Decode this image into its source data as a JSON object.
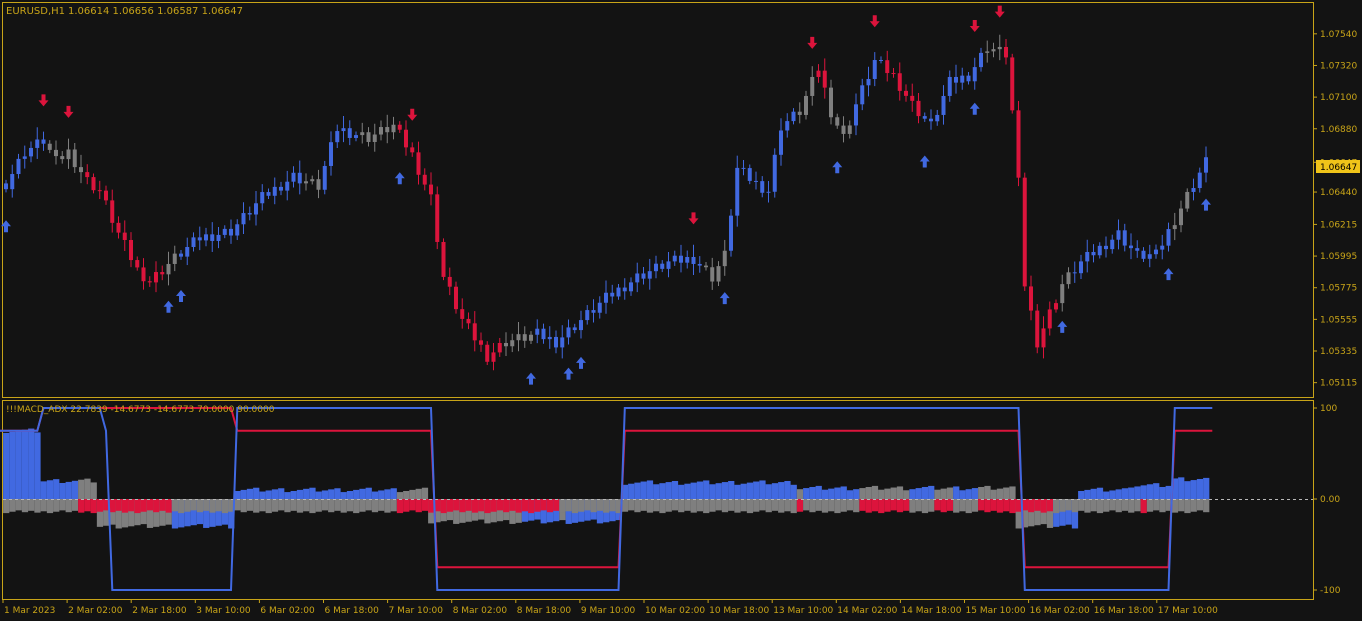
{
  "colors": {
    "background": "#131313",
    "frame": "#c8a418",
    "text": "#c8a418",
    "bull": "#4169e1",
    "bear": "#dc143c",
    "neutral": "#7f7f7f",
    "price_tag_bg": "#f0c419",
    "price_tag_text": "#000000"
  },
  "main_header": {
    "symbol": "EURUSD,H1",
    "ohlc": "1.06614 1.06656 1.06587 1.06647"
  },
  "indicator_header": {
    "label": "!!!MACD_ADX 22.7839 -14.6773 -14.6773 70.0000 90.0000"
  },
  "price_axis": {
    "ticks": [
      "1.07540",
      "1.07320",
      "1.07100",
      "1.06880",
      "1.06647",
      "1.06440",
      "1.06215",
      "1.05995",
      "1.05775",
      "1.05555",
      "1.05335",
      "1.05115"
    ],
    "current_price_label": "1.06647"
  },
  "indicator_axis": {
    "ticks": [
      "100",
      "0.00",
      "-100"
    ]
  },
  "time_axis": {
    "labels": [
      "1 Mar 2023",
      "2 Mar 02:00",
      "2 Mar 18:00",
      "3 Mar 10:00",
      "6 Mar 02:00",
      "6 Mar 18:00",
      "7 Mar 10:00",
      "8 Mar 02:00",
      "8 Mar 18:00",
      "9 Mar 10:00",
      "10 Mar 02:00",
      "10 Mar 18:00",
      "13 Mar 10:00",
      "14 Mar 02:00",
      "14 Mar 18:00",
      "15 Mar 10:00",
      "16 Mar 02:00",
      "16 Mar 18:00",
      "17 Mar 10:00"
    ]
  },
  "chart_data": [
    {
      "type": "candlestick",
      "title": "EURUSD,H1",
      "ylim": [
        1.0505,
        1.0765
      ],
      "candle_count": 193,
      "close_path": [
        {
          "i": 0,
          "v": 1.065
        },
        {
          "i": 3,
          "v": 1.0672
        },
        {
          "i": 6,
          "v": 1.068
        },
        {
          "i": 8,
          "v": 1.0665
        },
        {
          "i": 10,
          "v": 1.0672
        },
        {
          "i": 13,
          "v": 1.0652
        },
        {
          "i": 15,
          "v": 1.0645
        },
        {
          "i": 18,
          "v": 1.0615
        },
        {
          "i": 21,
          "v": 1.059
        },
        {
          "i": 23,
          "v": 1.0582
        },
        {
          "i": 27,
          "v": 1.0598
        },
        {
          "i": 31,
          "v": 1.0612
        },
        {
          "i": 36,
          "v": 1.0617
        },
        {
          "i": 41,
          "v": 1.064
        },
        {
          "i": 46,
          "v": 1.0655
        },
        {
          "i": 50,
          "v": 1.0648
        },
        {
          "i": 53,
          "v": 1.0688
        },
        {
          "i": 58,
          "v": 1.0682
        },
        {
          "i": 62,
          "v": 1.069
        },
        {
          "i": 65,
          "v": 1.067
        },
        {
          "i": 68,
          "v": 1.064
        },
        {
          "i": 70,
          "v": 1.0585
        },
        {
          "i": 73,
          "v": 1.0555
        },
        {
          "i": 77,
          "v": 1.053
        },
        {
          "i": 80,
          "v": 1.054
        },
        {
          "i": 85,
          "v": 1.0545
        },
        {
          "i": 88,
          "v": 1.054
        },
        {
          "i": 92,
          "v": 1.0555
        },
        {
          "i": 96,
          "v": 1.057
        },
        {
          "i": 101,
          "v": 1.0585
        },
        {
          "i": 106,
          "v": 1.0595
        },
        {
          "i": 110,
          "v": 1.0598
        },
        {
          "i": 113,
          "v": 1.0585
        },
        {
          "i": 115,
          "v": 1.06
        },
        {
          "i": 117,
          "v": 1.066
        },
        {
          "i": 120,
          "v": 1.065
        },
        {
          "i": 122,
          "v": 1.0645
        },
        {
          "i": 124,
          "v": 1.069
        },
        {
          "i": 127,
          "v": 1.07
        },
        {
          "i": 130,
          "v": 1.073
        },
        {
          "i": 132,
          "v": 1.07
        },
        {
          "i": 134,
          "v": 1.0682
        },
        {
          "i": 136,
          "v": 1.0705
        },
        {
          "i": 139,
          "v": 1.0735
        },
        {
          "i": 142,
          "v": 1.0725
        },
        {
          "i": 145,
          "v": 1.0705
        },
        {
          "i": 148,
          "v": 1.069
        },
        {
          "i": 151,
          "v": 1.072
        },
        {
          "i": 154,
          "v": 1.0725
        },
        {
          "i": 157,
          "v": 1.0745
        },
        {
          "i": 160,
          "v": 1.074
        },
        {
          "i": 161,
          "v": 1.07
        },
        {
          "i": 162,
          "v": 1.065
        },
        {
          "i": 163,
          "v": 1.058
        },
        {
          "i": 165,
          "v": 1.054
        },
        {
          "i": 167,
          "v": 1.056
        },
        {
          "i": 169,
          "v": 1.058
        },
        {
          "i": 172,
          "v": 1.0595
        },
        {
          "i": 175,
          "v": 1.0605
        },
        {
          "i": 178,
          "v": 1.0615
        },
        {
          "i": 181,
          "v": 1.06
        },
        {
          "i": 184,
          "v": 1.06
        },
        {
          "i": 187,
          "v": 1.0625
        },
        {
          "i": 190,
          "v": 1.065
        },
        {
          "i": 192,
          "v": 1.0665
        }
      ],
      "candle_color_runs": [
        {
          "from": 0,
          "to": 6,
          "color": "bull"
        },
        {
          "from": 7,
          "to": 12,
          "color": "neutral"
        },
        {
          "from": 13,
          "to": 25,
          "color": "bear"
        },
        {
          "from": 26,
          "to": 27,
          "color": "neutral"
        },
        {
          "from": 28,
          "to": 47,
          "color": "bull"
        },
        {
          "from": 48,
          "to": 50,
          "color": "neutral"
        },
        {
          "from": 51,
          "to": 56,
          "color": "bull"
        },
        {
          "from": 57,
          "to": 62,
          "color": "neutral"
        },
        {
          "from": 63,
          "to": 79,
          "color": "bear"
        },
        {
          "from": 80,
          "to": 84,
          "color": "neutral"
        },
        {
          "from": 85,
          "to": 90,
          "color": "bull"
        },
        {
          "from": 91,
          "to": 111,
          "color": "bull"
        },
        {
          "from": 112,
          "to": 115,
          "color": "neutral"
        },
        {
          "from": 116,
          "to": 126,
          "color": "bull"
        },
        {
          "from": 127,
          "to": 129,
          "color": "neutral"
        },
        {
          "from": 130,
          "to": 131,
          "color": "bear"
        },
        {
          "from": 132,
          "to": 135,
          "color": "neutral"
        },
        {
          "from": 136,
          "to": 140,
          "color": "bull"
        },
        {
          "from": 141,
          "to": 146,
          "color": "bear"
        },
        {
          "from": 147,
          "to": 156,
          "color": "bull"
        },
        {
          "from": 157,
          "to": 159,
          "color": "neutral"
        },
        {
          "from": 160,
          "to": 168,
          "color": "bear"
        },
        {
          "from": 169,
          "to": 170,
          "color": "neutral"
        },
        {
          "from": 171,
          "to": 186,
          "color": "bull"
        },
        {
          "from": 187,
          "to": 189,
          "color": "neutral"
        },
        {
          "from": 190,
          "to": 192,
          "color": "bull"
        }
      ],
      "sell_arrows": [
        6,
        10,
        65,
        110,
        129,
        139,
        155,
        159
      ],
      "buy_arrows": [
        0,
        26,
        28,
        63,
        84,
        90,
        92,
        115,
        133,
        147,
        155,
        169,
        186,
        192
      ]
    },
    {
      "type": "histogram",
      "title": "!!!MACD_ADX",
      "ylim": [
        -100,
        100
      ],
      "bars": 193,
      "upper_segments": [
        {
          "from": -3,
          "to": 6,
          "v": 75
        },
        {
          "from": 6,
          "to": 15,
          "v": 20
        },
        {
          "from": 15,
          "to": 37,
          "v": -30
        },
        {
          "from": 37,
          "to": 68,
          "v": 10
        },
        {
          "from": 68,
          "to": 99,
          "v": -25
        },
        {
          "from": 99,
          "to": 127,
          "v": 18
        },
        {
          "from": 127,
          "to": 162,
          "v": 12
        },
        {
          "from": 162,
          "to": 172,
          "v": -30
        },
        {
          "from": 172,
          "to": 180,
          "v": 10
        },
        {
          "from": 180,
          "to": 187,
          "v": 15
        },
        {
          "from": 187,
          "to": 193,
          "v": 22
        }
      ],
      "lower_segments": [
        {
          "from": -3,
          "to": 193,
          "v": -14
        }
      ],
      "upper_color_runs": [
        {
          "from": 0,
          "to": 11,
          "color": "bull"
        },
        {
          "from": 12,
          "to": 26,
          "color": "neutral"
        },
        {
          "from": 27,
          "to": 62,
          "color": "bull"
        },
        {
          "from": 63,
          "to": 82,
          "color": "neutral"
        },
        {
          "from": 83,
          "to": 88,
          "color": "bull"
        },
        {
          "from": 89,
          "to": 89,
          "color": "neutral"
        },
        {
          "from": 90,
          "to": 126,
          "color": "bull"
        },
        {
          "from": 127,
          "to": 127,
          "color": "neutral"
        },
        {
          "from": 128,
          "to": 136,
          "color": "bull"
        },
        {
          "from": 137,
          "to": 144,
          "color": "neutral"
        },
        {
          "from": 145,
          "to": 148,
          "color": "bull"
        },
        {
          "from": 149,
          "to": 151,
          "color": "neutral"
        },
        {
          "from": 152,
          "to": 155,
          "color": "bull"
        },
        {
          "from": 156,
          "to": 167,
          "color": "neutral"
        },
        {
          "from": 168,
          "to": 181,
          "color": "bull"
        },
        {
          "from": 182,
          "to": 192,
          "color": "bull"
        }
      ],
      "lower_color_runs": [
        {
          "from": 0,
          "to": 11,
          "color": "neutral"
        },
        {
          "from": 12,
          "to": 26,
          "color": "bear"
        },
        {
          "from": 27,
          "to": 62,
          "color": "neutral"
        },
        {
          "from": 63,
          "to": 82,
          "color": "bear"
        },
        {
          "from": 83,
          "to": 88,
          "color": "bear"
        },
        {
          "from": 89,
          "to": 89,
          "color": "neutral"
        },
        {
          "from": 90,
          "to": 126,
          "color": "neutral"
        },
        {
          "from": 127,
          "to": 127,
          "color": "bear"
        },
        {
          "from": 128,
          "to": 136,
          "color": "neutral"
        },
        {
          "from": 137,
          "to": 144,
          "color": "bear"
        },
        {
          "from": 145,
          "to": 148,
          "color": "neutral"
        },
        {
          "from": 149,
          "to": 151,
          "color": "bear"
        },
        {
          "from": 152,
          "to": 155,
          "color": "neutral"
        },
        {
          "from": 156,
          "to": 167,
          "color": "bear"
        },
        {
          "from": 168,
          "to": 181,
          "color": "neutral"
        },
        {
          "from": 182,
          "to": 182,
          "color": "bear"
        },
        {
          "from": 183,
          "to": 192,
          "color": "neutral"
        }
      ],
      "state_lines": {
        "blue": [
          {
            "i": -3,
            "v": 75
          },
          {
            "i": 5,
            "v": 75
          },
          {
            "i": 6,
            "v": 100
          },
          {
            "i": 15,
            "v": 100
          },
          {
            "i": 16,
            "v": 75
          },
          {
            "i": 17,
            "v": -100
          },
          {
            "i": 36,
            "v": -100
          },
          {
            "i": 37,
            "v": 100
          },
          {
            "i": 68,
            "v": 100
          },
          {
            "i": 69,
            "v": -100
          },
          {
            "i": 98,
            "v": -100
          },
          {
            "i": 99,
            "v": 100
          },
          {
            "i": 162,
            "v": 100
          },
          {
            "i": 163,
            "v": -100
          },
          {
            "i": 186,
            "v": -100
          },
          {
            "i": 187,
            "v": 100
          },
          {
            "i": 193,
            "v": 100
          }
        ],
        "red": [
          {
            "i": -3,
            "v": 75
          },
          {
            "i": 5,
            "v": 75
          },
          {
            "i": 6,
            "v": 100
          },
          {
            "i": 36,
            "v": 100
          },
          {
            "i": 37,
            "v": 75
          },
          {
            "i": 68,
            "v": 75
          },
          {
            "i": 69,
            "v": -75
          },
          {
            "i": 98,
            "v": -75
          },
          {
            "i": 99,
            "v": 75
          },
          {
            "i": 162,
            "v": 75
          },
          {
            "i": 163,
            "v": -75
          },
          {
            "i": 186,
            "v": -75
          },
          {
            "i": 187,
            "v": 75
          },
          {
            "i": 193,
            "v": 75
          }
        ]
      }
    }
  ]
}
